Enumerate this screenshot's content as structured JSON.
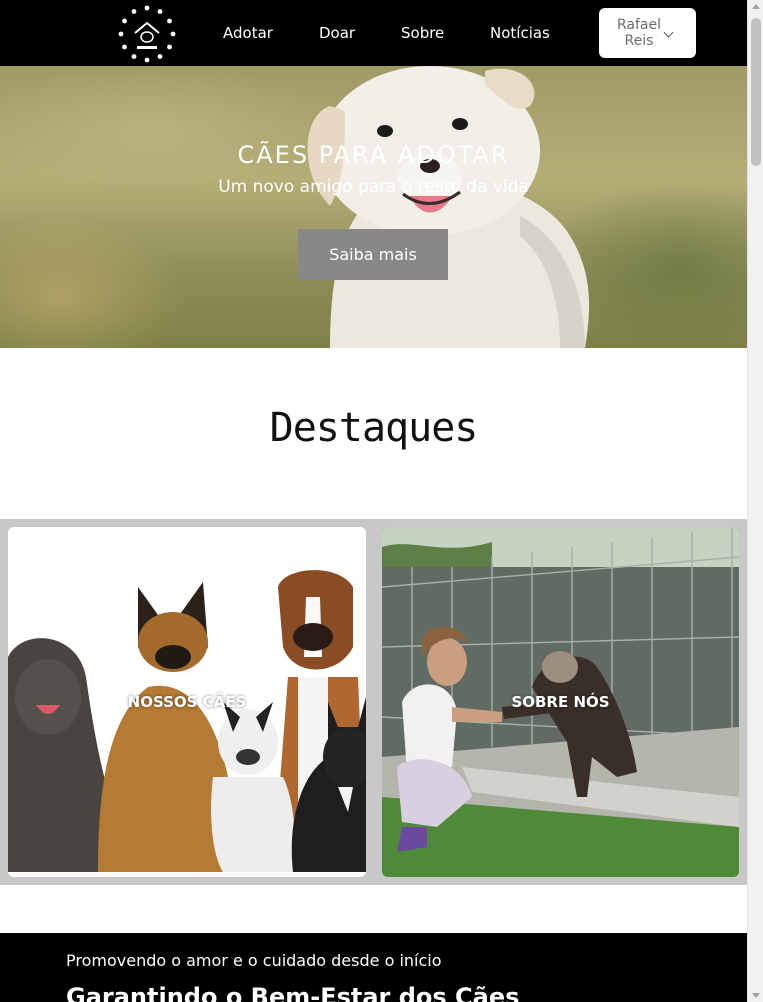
{
  "nav": {
    "logo_alt": "Dog House",
    "links": [
      "Adotar",
      "Doar",
      "Sobre",
      "Notícias"
    ],
    "user_first": "Rafael",
    "user_last": "Reis"
  },
  "hero": {
    "title": "CÃES PARA ADOTAR",
    "subtitle": "Um novo amigo para o resto da vida",
    "button": "Saiba mais"
  },
  "highlights": {
    "title": "Destaques",
    "cards": [
      "NOSSOS CÃES",
      "SOBRE NÓS"
    ]
  },
  "mission": {
    "kicker": "Promovendo o amor e o cuidado desde o início",
    "headline": "Garantindo o Bem-Estar dos Cães"
  }
}
